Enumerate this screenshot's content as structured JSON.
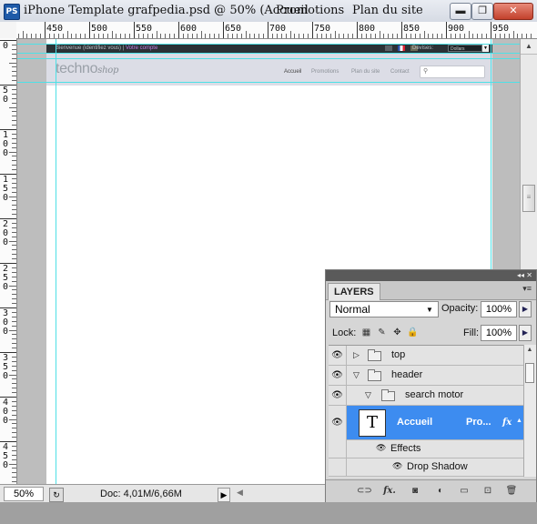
{
  "titlebar": {
    "app_icon": "PS",
    "segments": [
      "iPhone Template grafpedia.psd @ 50% (Accueil",
      "Promotions",
      "Plan du site"
    ],
    "buttons": {
      "minimize": "▬",
      "restore": "❐",
      "close": "✕"
    }
  },
  "ruler": {
    "h_labels": [
      "450",
      "500",
      "550",
      "600",
      "650",
      "700",
      "750",
      "800",
      "850",
      "900",
      "950"
    ],
    "v_labels": [
      "0",
      "50",
      "100",
      "150",
      "200",
      "250",
      "300",
      "350",
      "400",
      "450"
    ]
  },
  "website": {
    "welcome": "Bienvenue (identifiez vous)  |",
    "account": "Votre compte",
    "devises_label": "Devises:",
    "currency": "Dollars",
    "logo_main": "techno",
    "logo_sub": "shop",
    "nav": [
      "Accueil",
      "Promotions",
      "Plan du site",
      "Contact"
    ],
    "search_icon": "magnifier-icon"
  },
  "statusbar": {
    "zoom": "50%",
    "doc_info": "Doc: 4,01M/6,66M"
  },
  "layers_panel": {
    "tab_title": "LAYERS",
    "blend_mode": "Normal",
    "opacity_label": "Opacity:",
    "opacity_value": "100%",
    "lock_label": "Lock:",
    "fill_label": "Fill:",
    "fill_value": "100%",
    "layers": [
      {
        "name": "top",
        "type": "group",
        "expanded": false
      },
      {
        "name": "header",
        "type": "group",
        "expanded": true
      },
      {
        "name": "search motor",
        "type": "group",
        "expanded": true
      },
      {
        "name": "Accueil",
        "suffix": "Pro...",
        "type": "text",
        "selected": true,
        "thumb": "T",
        "fx": "fx"
      },
      {
        "name": "Effects",
        "type": "effects"
      },
      {
        "name": "Drop Shadow",
        "type": "effect"
      }
    ],
    "bottom_icons": [
      "link-layers-icon",
      "fx-icon",
      "mask-icon",
      "adjustment-icon",
      "new-group-icon",
      "new-layer-icon",
      "trash-icon"
    ]
  },
  "colors": {
    "selection": "#3d8cf0",
    "site_topbar": "#2b3236",
    "site_header": "#dcdde6",
    "guides": "#4ee0e6"
  }
}
